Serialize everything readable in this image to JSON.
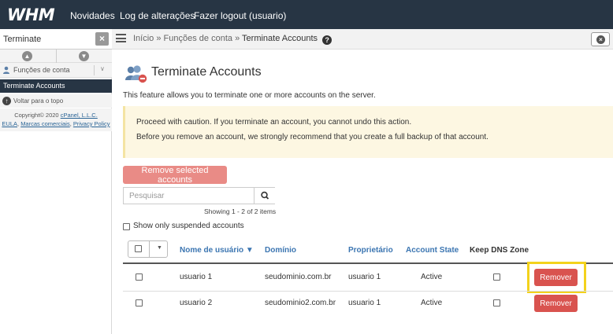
{
  "topbar": {
    "logo": "WHM",
    "nav": [
      "Novidades",
      "Log de alterações",
      "Fazer logout (usuario)"
    ]
  },
  "sidebar": {
    "search_value": "Terminate",
    "select_label": "Funções de conta",
    "active_item": "Terminate Accounts",
    "back_to_top": "Voltar para o topo",
    "copyright": "Copyright© 2020",
    "company_link": "cPanel, L.L.C.",
    "links": [
      "EULA",
      "Marcas comerciais",
      "Privacy Policy"
    ]
  },
  "breadcrumb": {
    "home": "Início",
    "sep": "»",
    "section": "Funções de conta",
    "current": "Terminate Accounts"
  },
  "page": {
    "title": "Terminate Accounts",
    "description": "This feature allows you to terminate one or more accounts on the server.",
    "warning_line1": "Proceed with caution. If you terminate an account, you cannot undo this action.",
    "warning_line2": "Before you remove an account, we strongly recommend that you create a full backup of that account.",
    "remove_selected_label": "Remove selected accounts",
    "search_placeholder": "Pesquisar",
    "showing": "Showing 1 - 2 of 2 items",
    "suspended_only_label": "Show only suspended accounts"
  },
  "table": {
    "columns": [
      "Nome de usuário ▼",
      "Domínio",
      "Proprietário",
      "Account State",
      "Keep DNS Zone"
    ],
    "rows": [
      {
        "user": "usuario 1",
        "domain": "seudominio.com.br",
        "owner": "usuario 1",
        "state": "Active",
        "action": "Remover"
      },
      {
        "user": "usuario 2",
        "domain": "seudominio2.com.br",
        "owner": "usuario 1",
        "state": "Active",
        "action": "Remover"
      }
    ]
  },
  "colors": {
    "topbar": "#273544",
    "link_blue": "#3b75b1",
    "danger": "#d9534f",
    "danger_disabled": "#e98b86",
    "warning_bg": "#fdf7e2",
    "highlight": "#f3d21c"
  }
}
